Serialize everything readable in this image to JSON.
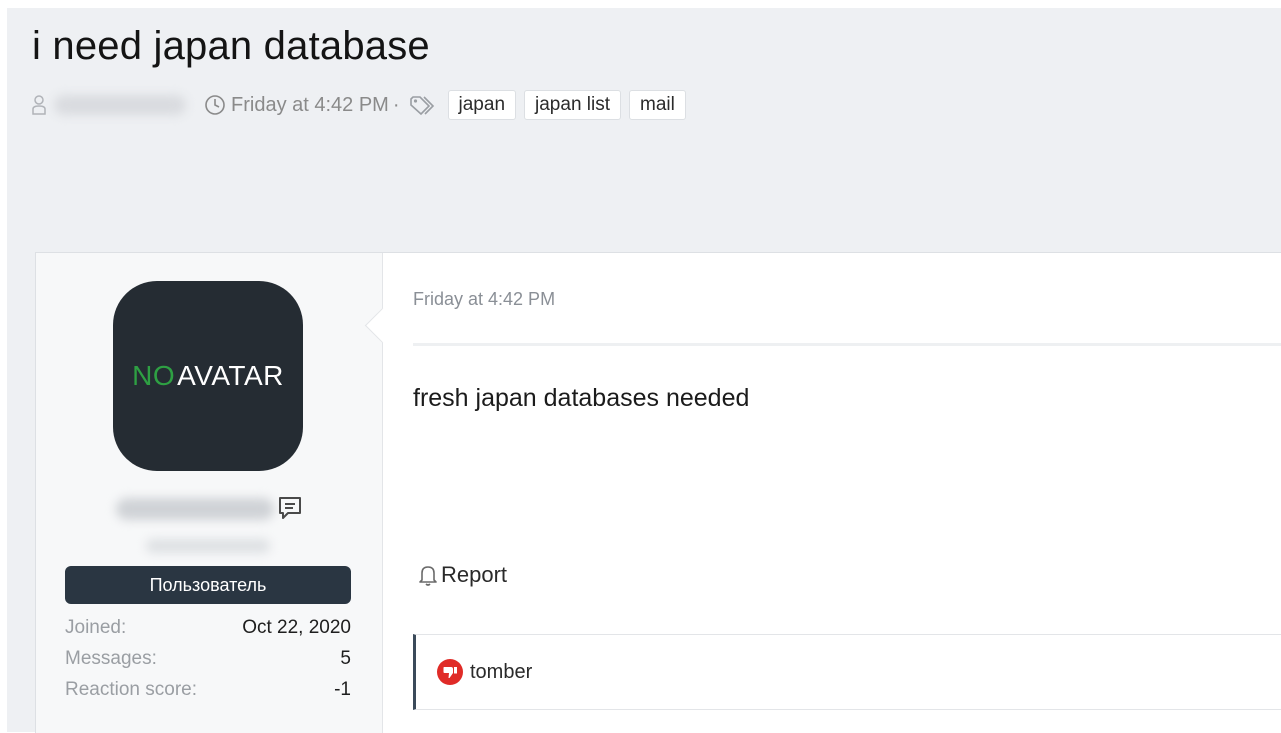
{
  "thread": {
    "title": "i need japan database",
    "timestamp": "Friday at 4:42 PM",
    "separator": "·",
    "tags": [
      "japan",
      "japan list",
      "mail"
    ]
  },
  "post": {
    "date": "Friday at 4:42 PM",
    "body": "fresh japan databases needed",
    "report_label": "Report"
  },
  "user": {
    "avatar_no": "NO",
    "avatar_text": "AVATAR",
    "role": "Пользователь",
    "stats": [
      {
        "label": "Joined:",
        "value": "Oct 22, 2020"
      },
      {
        "label": "Messages:",
        "value": "5"
      },
      {
        "label": "Reaction score:",
        "value": "-1"
      }
    ]
  },
  "reactions": {
    "user": "tomber"
  },
  "icons": {
    "user": "user-icon",
    "clock": "clock-icon",
    "tag": "tag-icon",
    "message": "message-icon",
    "bell": "bell-icon",
    "dislike": "dislike-icon"
  },
  "colors": {
    "header_bg": "#eef0f3",
    "avatar_bg": "#252c33",
    "avatar_no": "#2ea043",
    "role_badge": "#2a3642",
    "dislike": "#e02b27"
  }
}
